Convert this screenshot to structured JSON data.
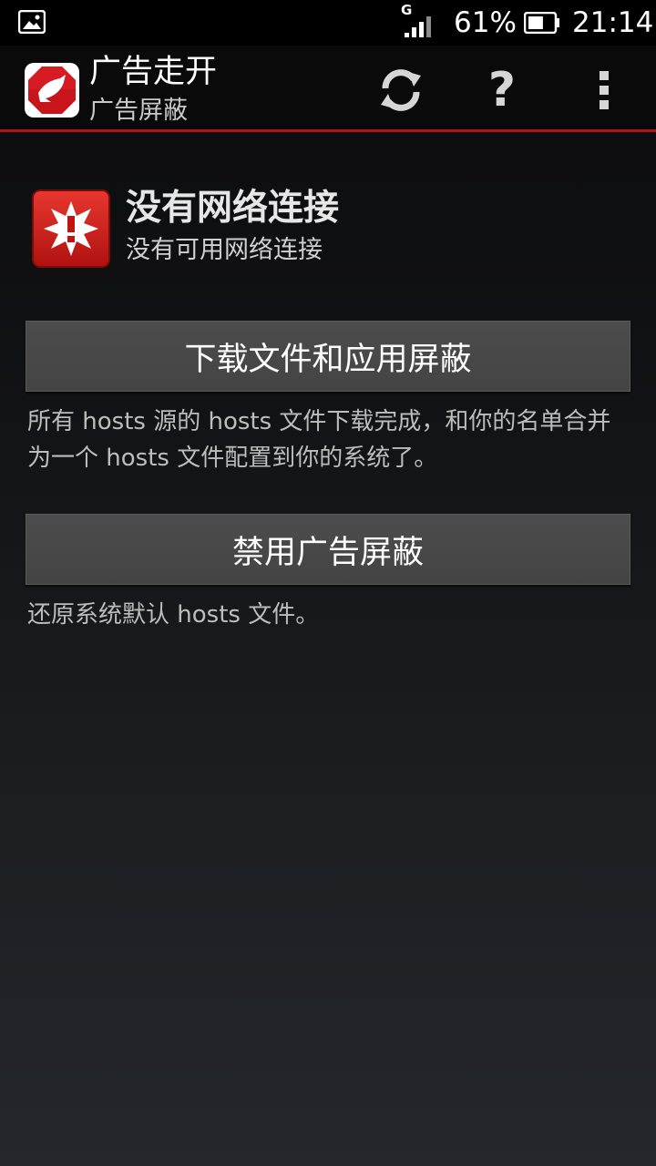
{
  "status_bar": {
    "network_type": "G",
    "battery_percent": "61%",
    "battery_level": 0.61,
    "time": "21:14",
    "icons": [
      "gallery-notification-icon",
      "signal-icon",
      "battery-icon"
    ]
  },
  "action_bar": {
    "title": "广告走开",
    "subtitle": "广告屏蔽",
    "accent_color": "#b31217",
    "actions": [
      {
        "name": "refresh",
        "icon": "refresh-icon"
      },
      {
        "name": "help",
        "icon": "help-icon",
        "glyph": "?"
      },
      {
        "name": "overflow",
        "icon": "overflow-menu-icon"
      }
    ]
  },
  "status": {
    "icon": "warning-icon",
    "title": "没有网络连接",
    "subtitle": "没有可用网络连接"
  },
  "apply": {
    "button_label": "下载文件和应用屏蔽",
    "description": "所有 hosts 源的 hosts 文件下载完成，和你的名单合并为一个 hosts 文件配置到你的系统了。"
  },
  "disable": {
    "button_label": "禁用广告屏蔽",
    "description": "还原系统默认 hosts 文件。"
  }
}
